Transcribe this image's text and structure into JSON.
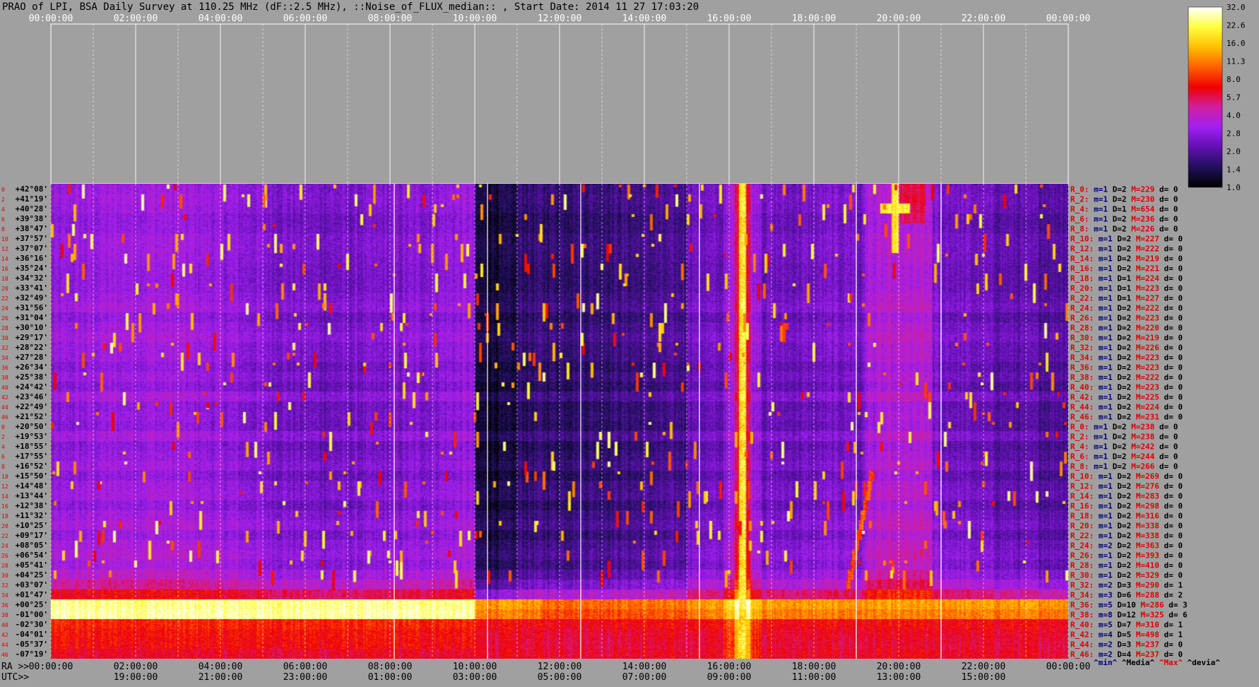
{
  "title": "PRAO of LPI, BSA Daily Survey at 110.25 MHz (dF::2.5 MHz), ::Noise_of_FLUX_median:: , Start Date: 2014 11 27 17:03:20",
  "axis": {
    "top_ticks": [
      "00:00:00",
      "02:00:00",
      "04:00:00",
      "06:00:00",
      "08:00:00",
      "10:00:00",
      "12:00:00",
      "14:00:00",
      "16:00:00",
      "18:00:00",
      "20:00:00",
      "22:00:00",
      "00:00:00"
    ],
    "ra_prefix": "RA >>",
    "bottom_ra_ticks": [
      "00:00:00",
      "02:00:00",
      "04:00:00",
      "06:00:00",
      "08:00:00",
      "10:00:00",
      "12:00:00",
      "14:00:00",
      "16:00:00",
      "18:00:00",
      "20:00:00",
      "22:00:00",
      "00:00:00"
    ],
    "utc_prefix": "UTC>>",
    "bottom_utc_ticks": [
      "19:00:00",
      "21:00:00",
      "23:00:00",
      "01:00:00",
      "03:00:00",
      "05:00:00",
      "07:00:00",
      "09:00:00",
      "11:00:00",
      "13:00:00",
      "15:00:00"
    ]
  },
  "declinations": [
    "+42°08'",
    "+41°19'",
    "+40°28'",
    "+39°38'",
    "+38°47'",
    "+37°57'",
    "+37°07'",
    "+36°16'",
    "+35°24'",
    "+34°32'",
    "+33°41'",
    "+32°49'",
    "+31°56'",
    "+31°04'",
    "+30°10'",
    "+29°17'",
    "+28°22'",
    "+27°28'",
    "+26°34'",
    "+25°38'",
    "+24°42'",
    "+23°46'",
    "+22°49'",
    "+21°52'",
    "+20°50'",
    "+19°53'",
    "+18°55'",
    "+17°55'",
    "+16°52'",
    "+15°50'",
    "+14°48'",
    "+13°44'",
    "+12°38'",
    "+11°32'",
    "+10°25'",
    "+09°17'",
    "+08°05'",
    "+06°54'",
    "+05°41'",
    "+04°25'",
    "+03°07'",
    "+01°47'",
    "+00°25'",
    "-01°00'",
    "-02°30'",
    "-04°01'",
    "-05°37'",
    "-07°19'"
  ],
  "row_index_labels": [
    "0",
    "2",
    "4",
    "6",
    "8",
    "10",
    "12",
    "14",
    "16",
    "18",
    "20",
    "22",
    "24",
    "26",
    "28",
    "30",
    "32",
    "34",
    "36",
    "38",
    "40",
    "42",
    "44",
    "46",
    "0",
    "2",
    "4",
    "6",
    "8",
    "10",
    "12",
    "14",
    "16",
    "18",
    "20",
    "22",
    "24",
    "26",
    "28",
    "30",
    "32",
    "34",
    "36",
    "38",
    "40",
    "42",
    "44",
    "46"
  ],
  "right_stats": [
    {
      "r": "R_0:",
      "m": "m=1",
      "D": "D=2",
      "M": "M=229",
      "d": "d= 0"
    },
    {
      "r": "R_2:",
      "m": "m=1",
      "D": "D=2",
      "M": "M=230",
      "d": "d= 0"
    },
    {
      "r": "R_4:",
      "m": "m=1",
      "D": "D=1",
      "M": "M=654",
      "d": "d= 0"
    },
    {
      "r": "R_6:",
      "m": "m=1",
      "D": "D=2",
      "M": "M=236",
      "d": "d= 0"
    },
    {
      "r": "R_8:",
      "m": "m=1",
      "D": "D=2",
      "M": "M=226",
      "d": "d= 0"
    },
    {
      "r": "R_10:",
      "m": "m=1",
      "D": "D=2",
      "M": "M=227",
      "d": "d= 0"
    },
    {
      "r": "R_12:",
      "m": "m=1",
      "D": "D=2",
      "M": "M=222",
      "d": "d= 0"
    },
    {
      "r": "R_14:",
      "m": "m=1",
      "D": "D=2",
      "M": "M=219",
      "d": "d= 0"
    },
    {
      "r": "R_16:",
      "m": "m=1",
      "D": "D=2",
      "M": "M=221",
      "d": "d= 0"
    },
    {
      "r": "R_18:",
      "m": "m=1",
      "D": "D=1",
      "M": "M=224",
      "d": "d= 0"
    },
    {
      "r": "R_20:",
      "m": "m=1",
      "D": "D=1",
      "M": "M=223",
      "d": "d= 0"
    },
    {
      "r": "R_22:",
      "m": "m=1",
      "D": "D=1",
      "M": "M=227",
      "d": "d= 0"
    },
    {
      "r": "R_24:",
      "m": "m=1",
      "D": "D=2",
      "M": "M=222",
      "d": "d= 0"
    },
    {
      "r": "R_26:",
      "m": "m=1",
      "D": "D=2",
      "M": "M=223",
      "d": "d= 0"
    },
    {
      "r": "R_28:",
      "m": "m=1",
      "D": "D=2",
      "M": "M=220",
      "d": "d= 0"
    },
    {
      "r": "R_30:",
      "m": "m=1",
      "D": "D=2",
      "M": "M=219",
      "d": "d= 0"
    },
    {
      "r": "R_32:",
      "m": "m=1",
      "D": "D=2",
      "M": "M=226",
      "d": "d= 0"
    },
    {
      "r": "R_34:",
      "m": "m=1",
      "D": "D=2",
      "M": "M=223",
      "d": "d= 0"
    },
    {
      "r": "R_36:",
      "m": "m=1",
      "D": "D=2",
      "M": "M=223",
      "d": "d= 0"
    },
    {
      "r": "R_38:",
      "m": "m=1",
      "D": "D=2",
      "M": "M=222",
      "d": "d= 0"
    },
    {
      "r": "R_40:",
      "m": "m=1",
      "D": "D=2",
      "M": "M=223",
      "d": "d= 0"
    },
    {
      "r": "R_42:",
      "m": "m=1",
      "D": "D=2",
      "M": "M=225",
      "d": "d= 0"
    },
    {
      "r": "R_44:",
      "m": "m=1",
      "D": "D=2",
      "M": "M=224",
      "d": "d= 0"
    },
    {
      "r": "R_46:",
      "m": "m=1",
      "D": "D=2",
      "M": "M=231",
      "d": "d= 0"
    },
    {
      "r": "R_0:",
      "m": "m=1",
      "D": "D=2",
      "M": "M=238",
      "d": "d= 0"
    },
    {
      "r": "R_2:",
      "m": "m=1",
      "D": "D=2",
      "M": "M=238",
      "d": "d= 0"
    },
    {
      "r": "R_4:",
      "m": "m=1",
      "D": "D=2",
      "M": "M=242",
      "d": "d= 0"
    },
    {
      "r": "R_6:",
      "m": "m=1",
      "D": "D=2",
      "M": "M=244",
      "d": "d= 0"
    },
    {
      "r": "R_8:",
      "m": "m=1",
      "D": "D=2",
      "M": "M=266",
      "d": "d= 0"
    },
    {
      "r": "R_10:",
      "m": "m=1",
      "D": "D=2",
      "M": "M=269",
      "d": "d= 0"
    },
    {
      "r": "R_12:",
      "m": "m=1",
      "D": "D=2",
      "M": "M=276",
      "d": "d= 0"
    },
    {
      "r": "R_14:",
      "m": "m=1",
      "D": "D=2",
      "M": "M=283",
      "d": "d= 0"
    },
    {
      "r": "R_16:",
      "m": "m=1",
      "D": "D=2",
      "M": "M=298",
      "d": "d= 0"
    },
    {
      "r": "R_18:",
      "m": "m=1",
      "D": "D=2",
      "M": "M=316",
      "d": "d= 0"
    },
    {
      "r": "R_20:",
      "m": "m=1",
      "D": "D=2",
      "M": "M=338",
      "d": "d= 0"
    },
    {
      "r": "R_22:",
      "m": "m=1",
      "D": "D=2",
      "M": "M=338",
      "d": "d= 0"
    },
    {
      "r": "R_24:",
      "m": "m=2",
      "D": "D=2",
      "M": "M=363",
      "d": "d= 0"
    },
    {
      "r": "R_26:",
      "m": "m=1",
      "D": "D=2",
      "M": "M=393",
      "d": "d= 0"
    },
    {
      "r": "R_28:",
      "m": "m=1",
      "D": "D=2",
      "M": "M=410",
      "d": "d= 0"
    },
    {
      "r": "R_30:",
      "m": "m=1",
      "D": "D=2",
      "M": "M=329",
      "d": "d= 0"
    },
    {
      "r": "R_32:",
      "m": "m=2",
      "D": "D=3",
      "M": "M=290",
      "d": "d= 1"
    },
    {
      "r": "R_34:",
      "m": "m=3",
      "D": "D=6",
      "M": "M=288",
      "d": "d= 2"
    },
    {
      "r": "R_36:",
      "m": "m=5",
      "D": "D=10",
      "M": "M=286",
      "d": "d= 3"
    },
    {
      "r": "R_38:",
      "m": "m=8",
      "D": "D=12",
      "M": "M=325",
      "d": "d= 6"
    },
    {
      "r": "R_40:",
      "m": "m=5",
      "D": "D=7",
      "M": "M=310",
      "d": "d= 1"
    },
    {
      "r": "R_42:",
      "m": "m=4",
      "D": "D=5",
      "M": "M=498",
      "d": "d= 1"
    },
    {
      "r": "R_44:",
      "m": "m=2",
      "D": "D=3",
      "M": "M=237",
      "d": "d= 0"
    },
    {
      "r": "R_46:",
      "m": "m=2",
      "D": "D=4",
      "M": "M=237",
      "d": "d= 0"
    }
  ],
  "legend_keys": {
    "min": "^min^",
    "median": "^Media^",
    "max": "^Max^",
    "devia": "^devia^"
  },
  "colors": {
    "bg": "#a0a0a0",
    "r_label": "#e00000",
    "m_label": "#000080",
    "M_label": "#e00000",
    "text_black": "#000000"
  },
  "chart_data": {
    "type": "heatmap",
    "title": "PRAO of LPI, BSA Daily Survey at 110.25 MHz (dF::2.5 MHz), ::Noise_of_FLUX_median:: , Start Date: 2014 11 27 17:03:20",
    "x_axis": "RA (hours)",
    "x_range": [
      0,
      24
    ],
    "rows": 48,
    "colorbar": {
      "ticks": [
        "32.0",
        "22.6",
        "16.0",
        "11.3",
        "8.0",
        "5.7",
        "4.0",
        "2.8",
        "2.0",
        "1.4",
        "1.0"
      ],
      "scale": "log",
      "range": [
        1.0,
        32.0
      ],
      "colormap": [
        "#000000",
        "#20105a",
        "#6010b0",
        "#a020f0",
        "#d020a0",
        "#f00000",
        "#ff6000",
        "#ffc000",
        "#ffff40",
        "#ffffff"
      ]
    },
    "features": [
      {
        "name": "vertical source track",
        "ra_hours": 16.3
      },
      {
        "name": "bright source",
        "ra_hours": 19.9,
        "dec": "+40°28'"
      },
      {
        "name": "bright band",
        "dec_rows": [
          42,
          43
        ],
        "ra_hours": [
          0,
          10
        ]
      }
    ]
  }
}
